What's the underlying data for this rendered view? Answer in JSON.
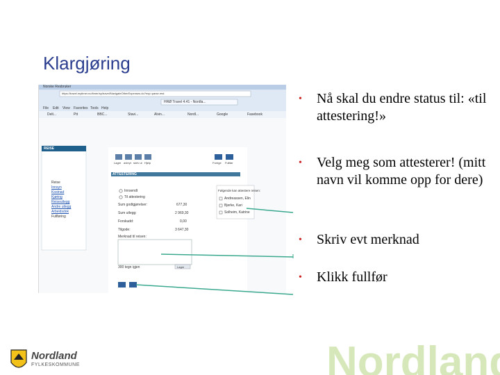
{
  "slide": {
    "title": "Klargjøring",
    "bullets": [
      "Nå skal du endre status til: «til attestering!»",
      "Velg meg som attesterer! (mitt navn vil komme opp for dere)",
      "Skriv evt merknad",
      "Klikk fullfør"
    ]
  },
  "browser": {
    "title": "Norske Resbruker",
    "address": "https://travel.mytimer.no/timer/sp/travel/NavigateOtherExpenses.do?exp=parse.rest",
    "tabs": [
      "HRØ Travel 4.41 - Nordla..."
    ],
    "menu": [
      "File",
      "Edit",
      "View",
      "Favorites",
      "Tools",
      "Help"
    ],
    "favorites": [
      "Delt...",
      "Ptt",
      "BBC...",
      "Stavi...",
      "Alvin...",
      "Nordl...",
      "Google",
      "Fasebook"
    ]
  },
  "app": {
    "left_panel_header": "REISE",
    "left_links": [
      "Reise",
      "Innsyn",
      "Kostnad",
      "Kjøring",
      "Reiseutlegg",
      "Andre utlegg",
      "Arbeidsdok",
      "Fullføring"
    ],
    "toolbar_left": [
      "Lagre",
      "avbryt",
      "skriv ut",
      "Hjelp"
    ],
    "toolbar_right": [
      "Forrige",
      "Fullfør"
    ],
    "section_header": "ATTESTERING",
    "radio_options": [
      "Innsendt",
      "Til attestering"
    ],
    "summary_rows": [
      {
        "label": "Sum godtgjørelser:",
        "value": "677,30"
      },
      {
        "label": "Sum utlegg:",
        "value": "2 969,30"
      },
      {
        "label": "Forskudd:",
        "value": "0,00"
      },
      {
        "label": "Tilgode:",
        "value": "3 647,30"
      }
    ],
    "merknad_label": "Merknad til reisen:",
    "char_counter": "300 tegn igjen",
    "save_small": "Lagre",
    "attester_header": "Følgende kan attestere reisen:",
    "attesters": [
      "Andreassen, Elin",
      "Bjerke, Kari",
      "Solheim, Katrine"
    ]
  },
  "footer": {
    "logo_name": "Nordland",
    "logo_sub": "FYLKESKOMMUNE",
    "watermark": "Nordland"
  },
  "colors": {
    "title": "#2a3d8f",
    "bullet_dot": "#cc2020",
    "arrow": "#3aa88f",
    "app_header": "#1f5f8b",
    "footer_green": "#8dbf3c"
  }
}
